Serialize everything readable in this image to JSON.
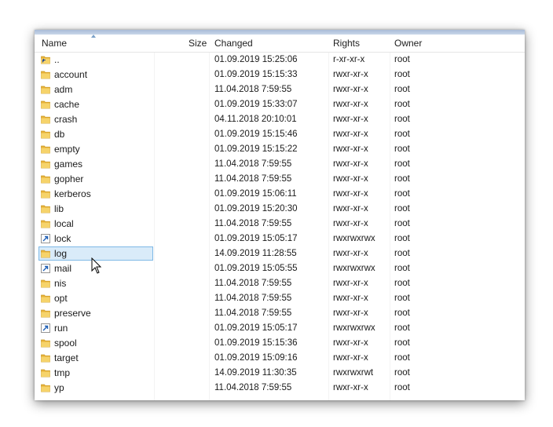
{
  "columns": {
    "name": "Name",
    "size": "Size",
    "changed": "Changed",
    "rights": "Rights",
    "owner": "Owner"
  },
  "colors": {
    "selection_bg": "#d9ebf9",
    "selection_border": "#7fb9e6",
    "folder_yellow": "#f2c64c"
  },
  "rows": [
    {
      "name": "..",
      "changed": "01.09.2019 15:25:06",
      "rights": "r-xr-xr-x",
      "owner": "root",
      "icon": "parent-folder-icon"
    },
    {
      "name": "account",
      "changed": "01.09.2019 15:15:33",
      "rights": "rwxr-xr-x",
      "owner": "root",
      "icon": "folder-icon"
    },
    {
      "name": "adm",
      "changed": "11.04.2018 7:59:55",
      "rights": "rwxr-xr-x",
      "owner": "root",
      "icon": "folder-icon"
    },
    {
      "name": "cache",
      "changed": "01.09.2019 15:33:07",
      "rights": "rwxr-xr-x",
      "owner": "root",
      "icon": "folder-icon"
    },
    {
      "name": "crash",
      "changed": "04.11.2018 20:10:01",
      "rights": "rwxr-xr-x",
      "owner": "root",
      "icon": "folder-icon"
    },
    {
      "name": "db",
      "changed": "01.09.2019 15:15:46",
      "rights": "rwxr-xr-x",
      "owner": "root",
      "icon": "folder-icon"
    },
    {
      "name": "empty",
      "changed": "01.09.2019 15:15:22",
      "rights": "rwxr-xr-x",
      "owner": "root",
      "icon": "folder-icon"
    },
    {
      "name": "games",
      "changed": "11.04.2018 7:59:55",
      "rights": "rwxr-xr-x",
      "owner": "root",
      "icon": "folder-icon"
    },
    {
      "name": "gopher",
      "changed": "11.04.2018 7:59:55",
      "rights": "rwxr-xr-x",
      "owner": "root",
      "icon": "folder-icon"
    },
    {
      "name": "kerberos",
      "changed": "01.09.2019 15:06:11",
      "rights": "rwxr-xr-x",
      "owner": "root",
      "icon": "folder-icon"
    },
    {
      "name": "lib",
      "changed": "01.09.2019 15:20:30",
      "rights": "rwxr-xr-x",
      "owner": "root",
      "icon": "folder-icon"
    },
    {
      "name": "local",
      "changed": "11.04.2018 7:59:55",
      "rights": "rwxr-xr-x",
      "owner": "root",
      "icon": "folder-icon"
    },
    {
      "name": "lock",
      "changed": "01.09.2019 15:05:17",
      "rights": "rwxrwxrwx",
      "owner": "root",
      "icon": "symlink-icon"
    },
    {
      "name": "log",
      "changed": "14.09.2019 11:28:55",
      "rights": "rwxr-xr-x",
      "owner": "root",
      "icon": "folder-icon",
      "selected": true
    },
    {
      "name": "mail",
      "changed": "01.09.2019 15:05:55",
      "rights": "rwxrwxrwx",
      "owner": "root",
      "icon": "symlink-icon"
    },
    {
      "name": "nis",
      "changed": "11.04.2018 7:59:55",
      "rights": "rwxr-xr-x",
      "owner": "root",
      "icon": "folder-icon"
    },
    {
      "name": "opt",
      "changed": "11.04.2018 7:59:55",
      "rights": "rwxr-xr-x",
      "owner": "root",
      "icon": "folder-icon"
    },
    {
      "name": "preserve",
      "changed": "11.04.2018 7:59:55",
      "rights": "rwxr-xr-x",
      "owner": "root",
      "icon": "folder-icon"
    },
    {
      "name": "run",
      "changed": "01.09.2019 15:05:17",
      "rights": "rwxrwxrwx",
      "owner": "root",
      "icon": "symlink-icon"
    },
    {
      "name": "spool",
      "changed": "01.09.2019 15:15:36",
      "rights": "rwxr-xr-x",
      "owner": "root",
      "icon": "folder-icon"
    },
    {
      "name": "target",
      "changed": "01.09.2019 15:09:16",
      "rights": "rwxr-xr-x",
      "owner": "root",
      "icon": "folder-icon"
    },
    {
      "name": "tmp",
      "changed": "14.09.2019 11:30:35",
      "rights": "rwxrwxrwt",
      "owner": "root",
      "icon": "folder-icon"
    },
    {
      "name": "yp",
      "changed": "11.04.2018 7:59:55",
      "rights": "rwxr-xr-x",
      "owner": "root",
      "icon": "folder-icon"
    }
  ]
}
